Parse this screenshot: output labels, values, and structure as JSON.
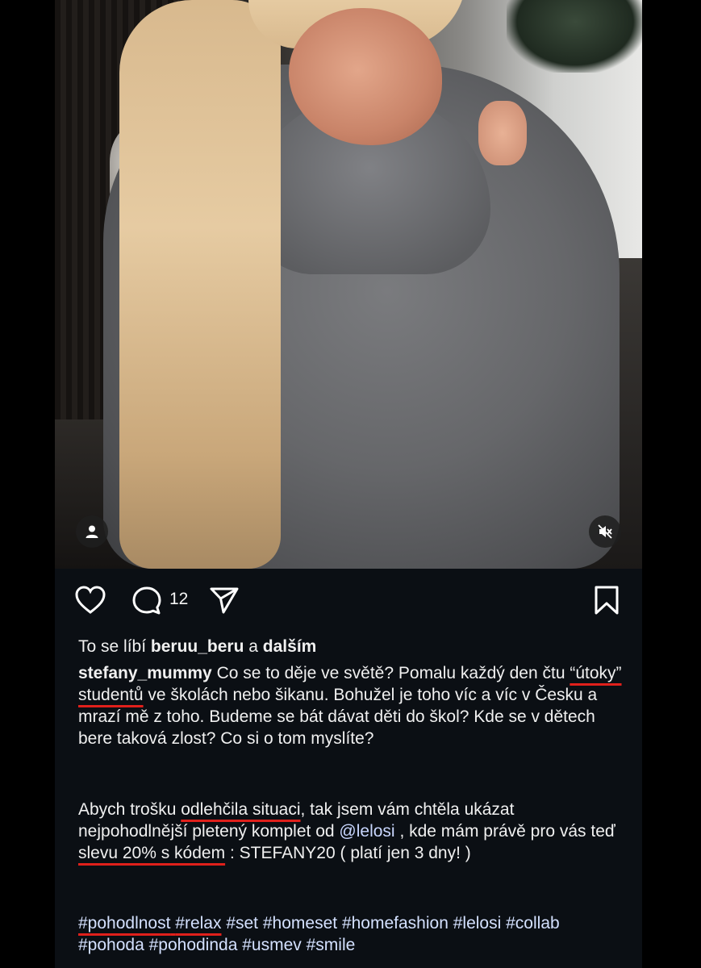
{
  "post": {
    "comment_count": "12",
    "likes": {
      "prefix": "To se líbí",
      "user": "beruu_beru",
      "middle": "a",
      "others": "dalším"
    },
    "caption": {
      "author": "stefany_mummy",
      "p1_a": "Co se to děje ve světě? Pomalu každý den čtu",
      "p1_quote": "“útoky” studentů",
      "p1_b": "ve školách nebo šikanu. Bohužel je toho víc a víc v Česku a mrazí mě z toho. Budeme se bát dávat děti do škol? Kde se v dětech bere taková zlost? Co si o tom myslíte?",
      "p2_a": "Abych trošku",
      "p2_hl1": "odlehčila situaci",
      "p2_b": ", tak jsem vám chtěla ukázat nejpohodlnější pletený komplet od",
      "p2_mention": "@lelosi",
      "p2_c": ", kde mám právě pro vás teď",
      "p2_hl2": "slevu 20% s kódem",
      "p2_d": ": STEFANY20 ( platí jen 3 dny! )"
    },
    "hashtags_underlined": [
      "#pohodlnost",
      "#relax"
    ],
    "hashtags": [
      "#set",
      "#homeset",
      "#homefashion",
      "#lelosi",
      "#collab",
      "#pohoda",
      "#pohodinda",
      "#usmev",
      "#smile"
    ]
  },
  "icons": [
    "user-icon",
    "mute-icon",
    "heart-icon",
    "comment-icon",
    "share-icon",
    "bookmark-icon"
  ],
  "colors": {
    "background": "#0b0f14",
    "text": "#f0f0f0",
    "underline": "#e0201b",
    "link": "#c9d7ff"
  }
}
